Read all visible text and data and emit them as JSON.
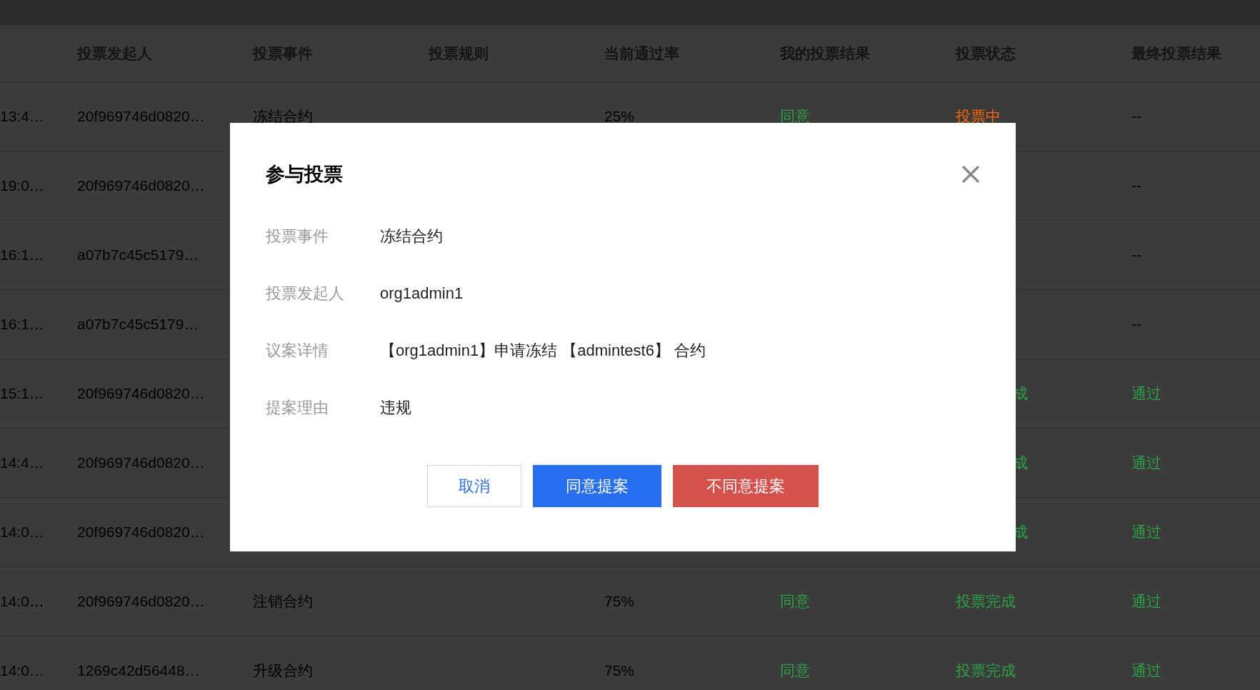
{
  "table": {
    "columns": [
      "投票发起人",
      "投票事件",
      "投票规则",
      "当前通过率",
      "我的投票结果",
      "投票状态",
      "最终投票结果"
    ],
    "rows": [
      {
        "time": "13:4…",
        "initiator": "20f969746d0820…",
        "event": "冻结合约",
        "rate": "25%",
        "my_vote": {
          "text": "同意",
          "color": "#2ba245"
        },
        "status": {
          "text": "投票中",
          "color": "#ff6a00",
          "clipped": false
        },
        "final": {
          "text": "--",
          "color": "#000000"
        }
      },
      {
        "time": "19:0…",
        "initiator": "20f969746d0820…",
        "final": {
          "text": "--",
          "color": "#000000"
        }
      },
      {
        "time": "16:1…",
        "initiator": "a07b7c45c5179…",
        "final": {
          "text": "--",
          "color": "#000000"
        }
      },
      {
        "time": "16:1…",
        "initiator": "a07b7c45c5179…",
        "final": {
          "text": "--",
          "color": "#000000"
        }
      },
      {
        "time": "15:1…",
        "initiator": "20f969746d0820…",
        "status": {
          "text": "成",
          "color": "#2ba245",
          "clipped": true
        },
        "final": {
          "text": "通过",
          "color": "#2ba245"
        }
      },
      {
        "time": "14:4…",
        "initiator": "20f969746d0820…",
        "status": {
          "text": "成",
          "color": "#2ba245",
          "clipped": true
        },
        "final": {
          "text": "通过",
          "color": "#2ba245"
        }
      },
      {
        "time": "14:0…",
        "initiator": "20f969746d0820…",
        "status": {
          "text": "成",
          "color": "#2ba245",
          "clipped": true
        },
        "final": {
          "text": "通过",
          "color": "#2ba245"
        }
      },
      {
        "time": "14:0…",
        "initiator": "20f969746d0820…",
        "event": "注销合约",
        "rate": "75%",
        "my_vote": {
          "text": "同意",
          "color": "#2ba245"
        },
        "status": {
          "text": "投票完成",
          "color": "#2ba245",
          "clipped": false
        },
        "final": {
          "text": "通过",
          "color": "#2ba245"
        }
      },
      {
        "time": "14:0…",
        "initiator": "1269c42d56448…",
        "event": "升级合约",
        "rate": "75%",
        "my_vote": {
          "text": "同意",
          "color": "#2ba245"
        },
        "status": {
          "text": "投票完成",
          "color": "#2ba245",
          "clipped": false
        },
        "final": {
          "text": "通过",
          "color": "#2ba245"
        }
      }
    ]
  },
  "dialog": {
    "title": "参与投票",
    "fields": [
      {
        "label": "投票事件",
        "value": "冻结合约"
      },
      {
        "label": "投票发起人",
        "value": "org1admin1"
      },
      {
        "label": "议案详情",
        "value": "【org1admin1】申请冻结 【admintest6】 合约"
      },
      {
        "label": "提案理由",
        "value": "违规"
      }
    ],
    "buttons": [
      {
        "label": "取消",
        "kind": "default"
      },
      {
        "label": "同意提案",
        "kind": "primary"
      },
      {
        "label": "不同意提案",
        "kind": "danger"
      }
    ]
  }
}
